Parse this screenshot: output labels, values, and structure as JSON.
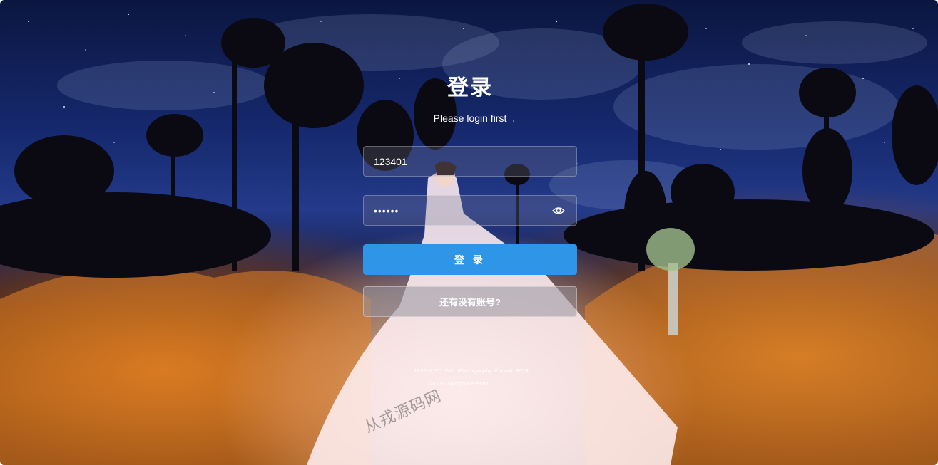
{
  "login": {
    "title": "登录",
    "subtitle": "Please login first",
    "username": {
      "value": "123401",
      "placeholder": ""
    },
    "password": {
      "value": "123456",
      "placeholder": "",
      "toggle_icon": "eye-icon"
    },
    "login_button_label": "登 录",
    "register_button_label": "还有没有账号?"
  },
  "background": {
    "studio_prefix": "JASON STUDIO",
    "studio_suffix": "Photography Classic 2019",
    "copyright": "©2019 Copyright Reserved",
    "watermark": "从戎源码网"
  },
  "colors": {
    "primary_button": "#2f95e6",
    "text": "#ffffff"
  }
}
